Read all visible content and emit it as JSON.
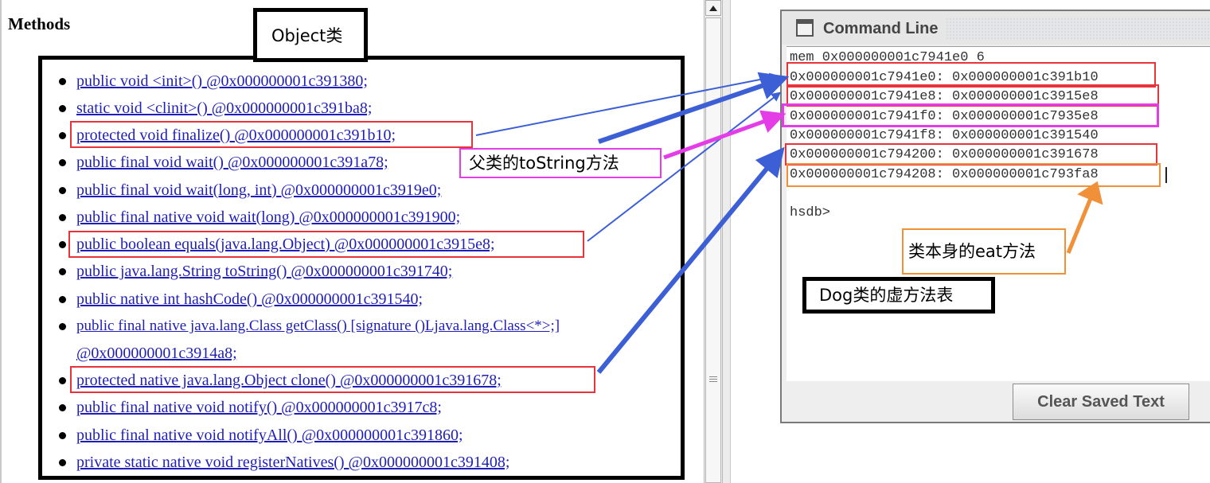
{
  "methods_panel": {
    "heading": "Methods",
    "items": [
      {
        "text": "public void <init>() @0x000000001c391380;"
      },
      {
        "text": "static void <clinit>() @0x000000001c391ba8;"
      },
      {
        "text": "protected void finalize() @0x000000001c391b10;"
      },
      {
        "text": "public final void wait() @0x000000001c391a78;"
      },
      {
        "text": "public final void wait(long, int) @0x000000001c3919e0;"
      },
      {
        "text": "public final native void wait(long) @0x000000001c391900;"
      },
      {
        "text": "public boolean equals(java.lang.Object) @0x000000001c3915e8;"
      },
      {
        "text": "public java.lang.String toString() @0x000000001c391740;"
      },
      {
        "text": "public native int hashCode() @0x000000001c391540;"
      },
      {
        "text": "public final native java.lang.Class getClass() [signature ()Ljava.lang.Class<*>;]",
        "text2": "@0x000000001c3914a8;"
      },
      {
        "text": "protected native java.lang.Object clone() @0x000000001c391678;"
      },
      {
        "text": "public final native void notify() @0x000000001c3917c8;"
      },
      {
        "text": "public final native void notifyAll() @0x000000001c391860;"
      },
      {
        "text": "private static native void registerNatives() @0x000000001c391408;"
      }
    ]
  },
  "command_window": {
    "title": "Command Line",
    "lines": [
      "mem 0x000000001c7941e0 6",
      "0x000000001c7941e0: 0x000000001c391b10",
      "0x000000001c7941e8: 0x000000001c3915e8",
      "0x000000001c7941f0: 0x000000001c7935e8",
      "0x000000001c7941f8: 0x000000001c391540",
      "0x000000001c794200: 0x000000001c391678",
      "0x000000001c794208: 0x000000001c793fa8",
      "",
      "hsdb>"
    ],
    "clear_button": "Clear Saved Text"
  },
  "annotations": {
    "object_class": "Object类",
    "parent_tostring": "父类的toString方法",
    "own_eat": "类本身的eat方法",
    "dog_vtable": "Dog类的虚方法表"
  },
  "colors": {
    "red": "#e8333a",
    "magenta": "#e43de8",
    "orange": "#f0913a",
    "blue_arrow": "#3d5fd6",
    "link": "#1f1fb8"
  }
}
